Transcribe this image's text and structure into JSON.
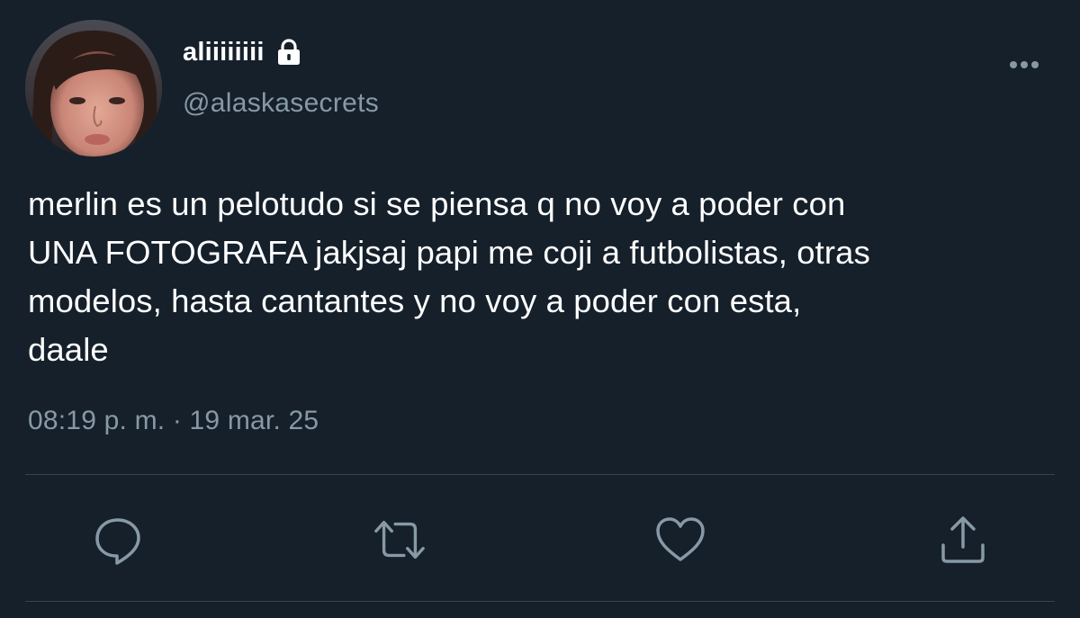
{
  "tweet": {
    "display_name": "aliiiiiiii",
    "handle": "@alaskasecrets",
    "text": "merlin es un pelotudo si se piensa q no voy a poder con\nUNA FOTOGRAFA jakjsaj papi me coji a futbolistas, otras\nmodelos, hasta cantantes y no voy a poder con esta,\ndaale",
    "timestamp": "08:19 p. m. · 19 mar. 25",
    "protected_icon": "lock-icon",
    "more_icon": "more-horizontal-icon"
  },
  "actions": [
    {
      "name": "reply",
      "icon": "reply-icon"
    },
    {
      "name": "retweet",
      "icon": "retweet-icon"
    },
    {
      "name": "like",
      "icon": "heart-icon"
    },
    {
      "name": "share",
      "icon": "share-icon"
    }
  ],
  "colors": {
    "background": "#15202b",
    "primary_text": "#ffffff",
    "secondary_text": "#8899a6",
    "divider": "#38444d"
  }
}
